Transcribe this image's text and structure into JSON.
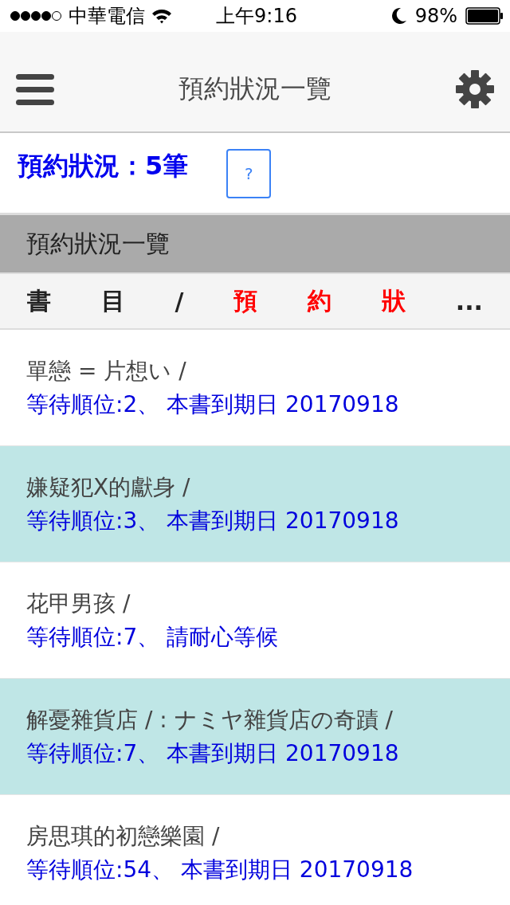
{
  "status_bar": {
    "carrier": "中華電信",
    "time": "上午9:16",
    "battery": "98%"
  },
  "nav": {
    "title": "預約狀況一覽"
  },
  "summary": {
    "text": "預約狀況：5筆",
    "help": "?"
  },
  "section": {
    "title": "預約狀況一覽"
  },
  "column_header": [
    {
      "text": "書",
      "kind": "title"
    },
    {
      "text": "目",
      "kind": "title"
    },
    {
      "text": "/",
      "kind": "title"
    },
    {
      "text": "預",
      "kind": "status"
    },
    {
      "text": "約",
      "kind": "status"
    },
    {
      "text": "狀",
      "kind": "status"
    },
    {
      "text": "...",
      "kind": "title"
    }
  ],
  "rows": [
    {
      "title": "單戀 = 片想い /",
      "status": "等待順位:2、 本書到期日 20170918"
    },
    {
      "title": "嫌疑犯X的獻身 /",
      "status": "等待順位:3、 本書到期日 20170918"
    },
    {
      "title": "花甲男孩 /",
      "status": "等待順位:7、 請耐心等候"
    },
    {
      "title": "解憂雜貨店 / : ナミヤ雜貨店の奇蹟 /",
      "status": "等待順位:7、 本書到期日 20170918"
    },
    {
      "title": "房思琪的初戀樂園 /",
      "status": "等待順位:54、 本書到期日 20170918"
    }
  ]
}
